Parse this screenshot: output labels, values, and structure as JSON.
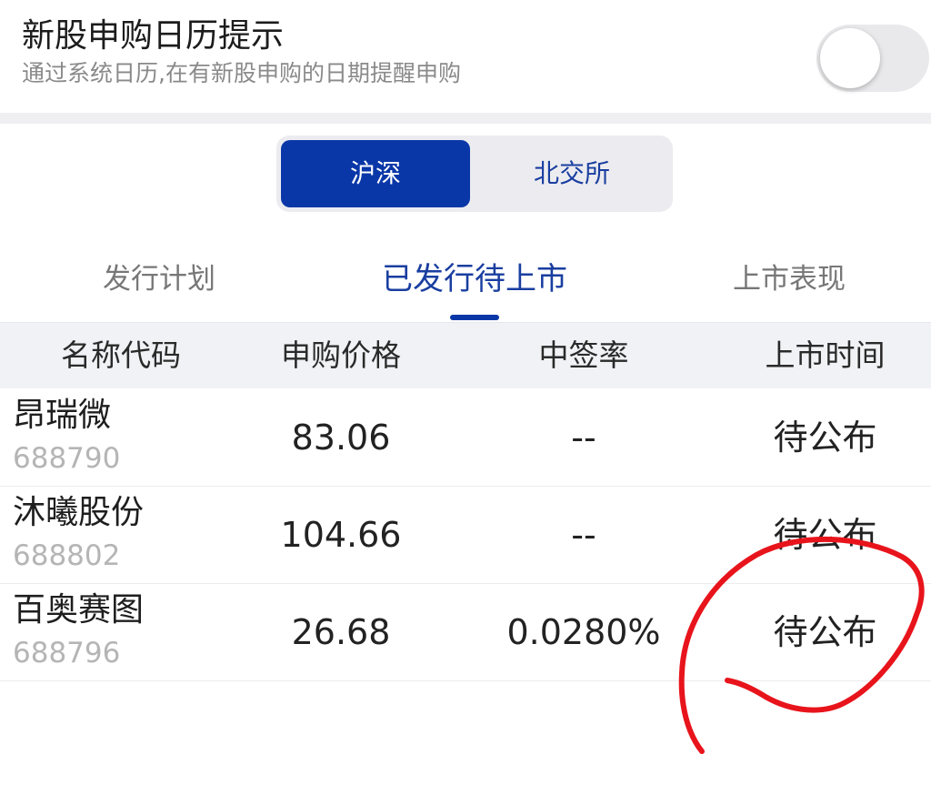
{
  "reminder": {
    "title": "新股申购日历提示",
    "subtitle": "通过系统日历,在有新股申购的日期提醒申购",
    "toggle_on": false
  },
  "market_segment": {
    "options": [
      "沪深",
      "北交所"
    ],
    "selected": "沪深"
  },
  "tabs": [
    {
      "label": "发行计划",
      "active": false
    },
    {
      "label": "已发行待上市",
      "active": true
    },
    {
      "label": "上市表现",
      "active": false
    }
  ],
  "table": {
    "columns": [
      "名称代码",
      "申购价格",
      "中签率",
      "上市时间"
    ],
    "rows": [
      {
        "name": "昂瑞微",
        "code": "688790",
        "price": "83.06",
        "rate": "--",
        "listing": "待公布"
      },
      {
        "name": "沐曦股份",
        "code": "688802",
        "price": "104.66",
        "rate": "--",
        "listing": "待公布"
      },
      {
        "name": "百奥赛图",
        "code": "688796",
        "price": "26.68",
        "rate": "0.0280%",
        "listing": "待公布"
      }
    ]
  },
  "colors": {
    "accent": "#0a37a8",
    "annotation": "#e8141c"
  }
}
